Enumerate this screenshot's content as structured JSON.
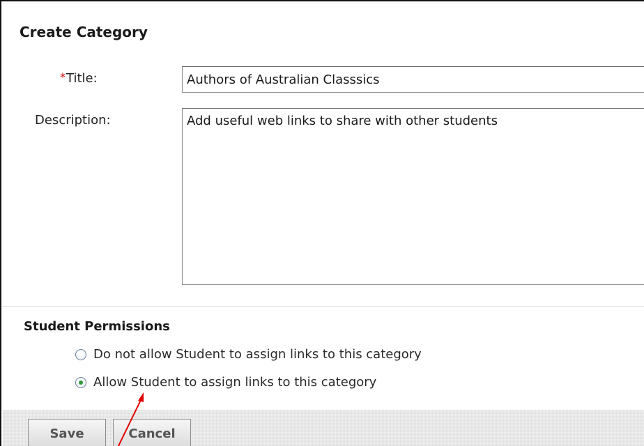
{
  "form": {
    "heading": "Create Category",
    "required_marker": "*",
    "title_label": "Title:",
    "title_value": "Authors of Australian Classsics",
    "description_label": "Description:",
    "description_value": "Add useful web links to share with other students"
  },
  "permissions": {
    "heading": "Student Permissions",
    "options": [
      {
        "label": "Do not allow Student to assign links to this category",
        "selected": false
      },
      {
        "label": "Allow Student to assign links to this category",
        "selected": true
      }
    ]
  },
  "buttons": {
    "save_label": "Save",
    "cancel_label": "Cancel"
  },
  "colors": {
    "required": "#cc0000",
    "annotation_arrow": "#e00000",
    "radio_selected": "#2f9a3a"
  }
}
